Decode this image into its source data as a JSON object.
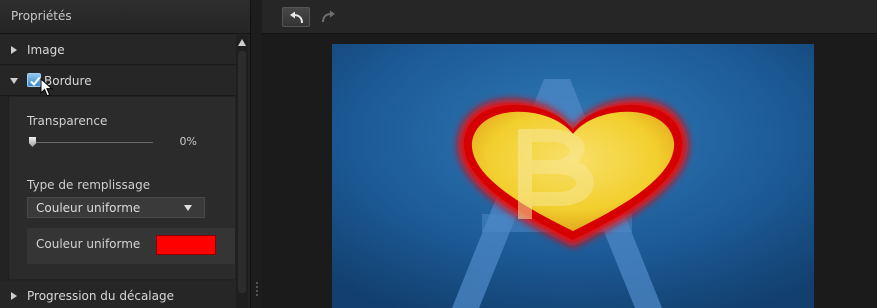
{
  "panel": {
    "title": "Propriétés",
    "sections": {
      "image": {
        "label": "Image",
        "expanded": false
      },
      "bordure": {
        "label": "Bordure",
        "expanded": true,
        "checked": true
      },
      "progression": {
        "label": "Progression du décalage",
        "expanded": false
      }
    },
    "bordure": {
      "transparency_label": "Transparence",
      "transparency_value": "0%",
      "transparency_fraction": 0,
      "fill_type_label": "Type de remplissage",
      "fill_type_value": "Couleur uniforme",
      "color_label": "Couleur uniforme",
      "color_value": "#ff0000"
    }
  },
  "toolbar": {
    "undo_icon": "undo-icon",
    "redo_icon": "redo-icon"
  },
  "icons": {
    "cursor": "mouse-cursor-icon",
    "scroll_up": "scroll-up-icon",
    "dropdown": "chevron-down-icon"
  },
  "colors": {
    "panel_bg": "#232323",
    "checkbox_accent": "#3b86c8",
    "preview_bg": "#1c5a96",
    "border_color": "#ff0000",
    "heart_fill": "#f2cf2e"
  }
}
